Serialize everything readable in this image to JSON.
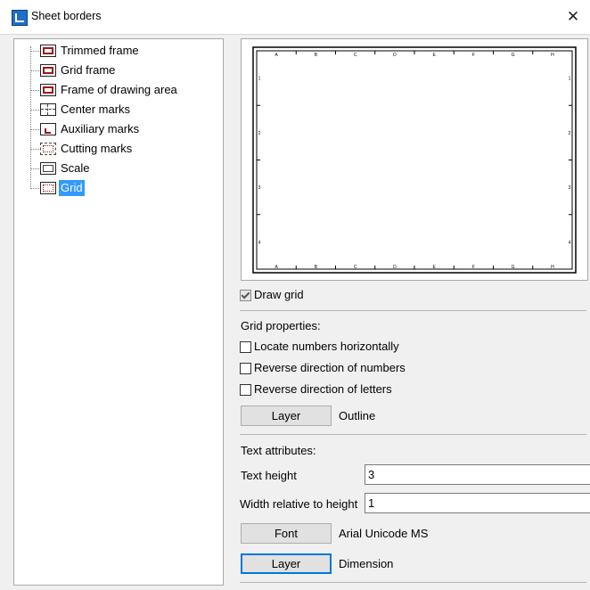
{
  "window": {
    "title": "Sheet borders"
  },
  "tree": {
    "items": [
      {
        "label": "Trimmed frame"
      },
      {
        "label": "Grid frame"
      },
      {
        "label": "Frame of drawing area"
      },
      {
        "label": "Center marks"
      },
      {
        "label": "Auxiliary marks"
      },
      {
        "label": "Cutting marks"
      },
      {
        "label": "Scale"
      },
      {
        "label": "Grid",
        "selected": true
      }
    ]
  },
  "preview": {
    "columns": [
      "A",
      "B",
      "C",
      "D",
      "E",
      "F",
      "G",
      "H"
    ],
    "rows": [
      "1",
      "2",
      "3",
      "4"
    ]
  },
  "options": {
    "draw_grid": {
      "label": "Draw grid",
      "checked": true
    },
    "grid_properties_label": "Grid properties:",
    "locate_numbers": {
      "label": "Locate numbers horizontally",
      "checked": false
    },
    "reverse_numbers": {
      "label": "Reverse direction of numbers",
      "checked": false
    },
    "reverse_letters": {
      "label": "Reverse direction of letters",
      "checked": false
    },
    "layer_button_label": "Layer",
    "layer_value": "Outline"
  },
  "text_attributes": {
    "heading": "Text attributes:",
    "text_height_label": "Text height",
    "text_height_value": "3",
    "width_label": "Width relative to height",
    "width_value": "1",
    "font_button_label": "Font",
    "font_value": "Arial Unicode MS",
    "layer_button_label": "Layer",
    "layer_value": "Dimension"
  }
}
